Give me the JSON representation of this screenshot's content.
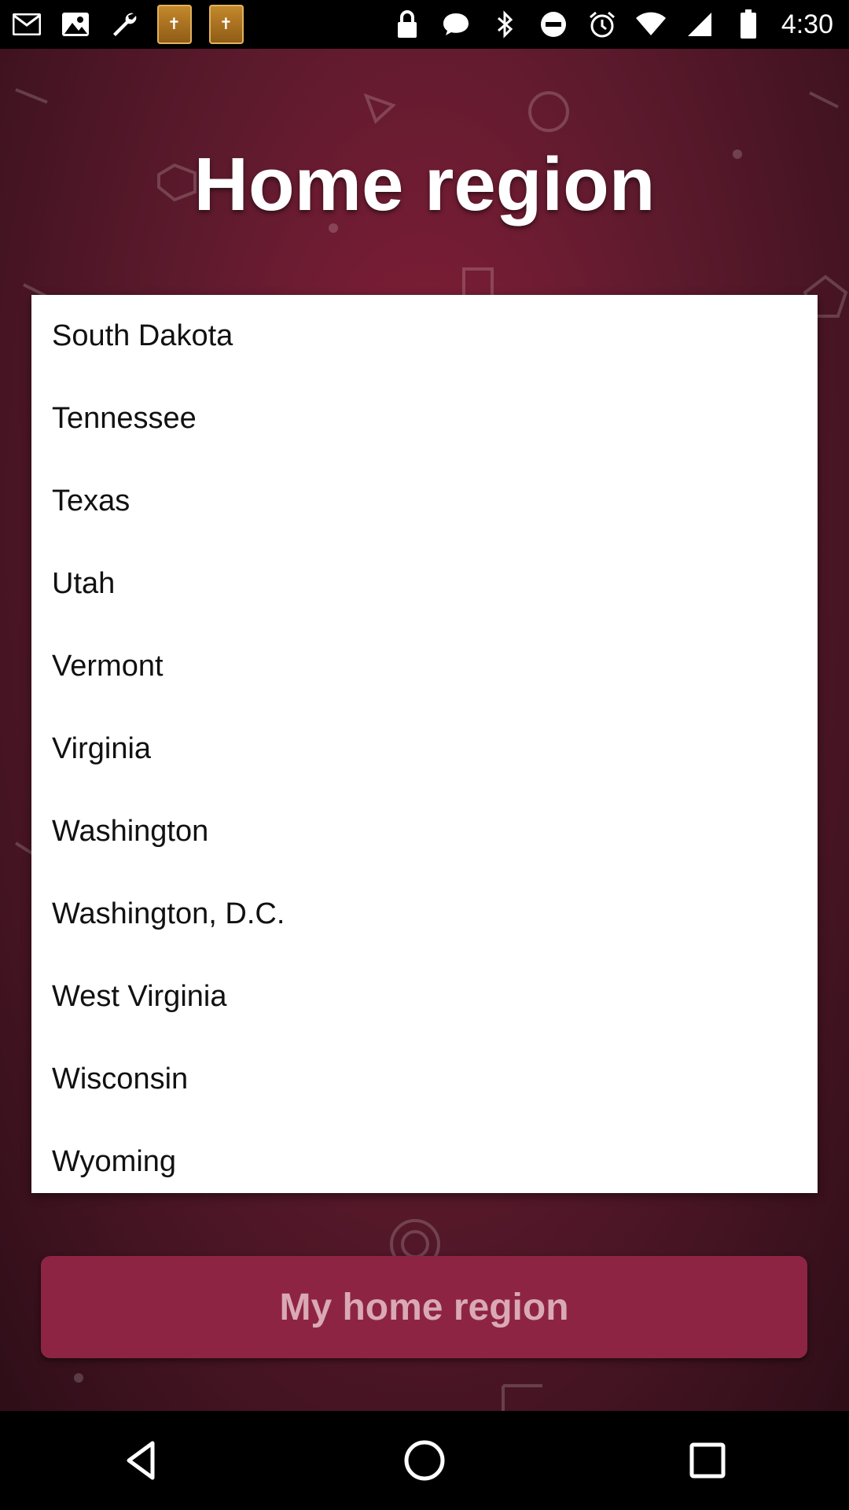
{
  "status_bar": {
    "time": "4:30",
    "notification_icons": [
      "email-icon",
      "image-icon",
      "wrench-icon",
      "topics-app-icon",
      "topics-app-icon"
    ],
    "system_icons": [
      "lock-icon",
      "message-icon",
      "bluetooth-icon",
      "do-not-disturb-icon",
      "alarm-icon",
      "wifi-icon",
      "signal-icon",
      "battery-icon"
    ]
  },
  "header": {
    "title": "Home region"
  },
  "region_list": {
    "items": [
      "South Dakota",
      "Tennessee",
      "Texas",
      "Utah",
      "Vermont",
      "Virginia",
      "Washington",
      "Washington, D.C.",
      "West Virginia",
      "Wisconsin",
      "Wyoming"
    ]
  },
  "action": {
    "button_label": "My home region"
  },
  "nav_bar": {
    "buttons": [
      "back-icon",
      "home-icon",
      "recents-icon"
    ]
  },
  "colors": {
    "background_center": "#8a1f3a",
    "background_edge": "#2e0e18",
    "button": "#8e2443",
    "button_text": "#d9a9b6"
  }
}
